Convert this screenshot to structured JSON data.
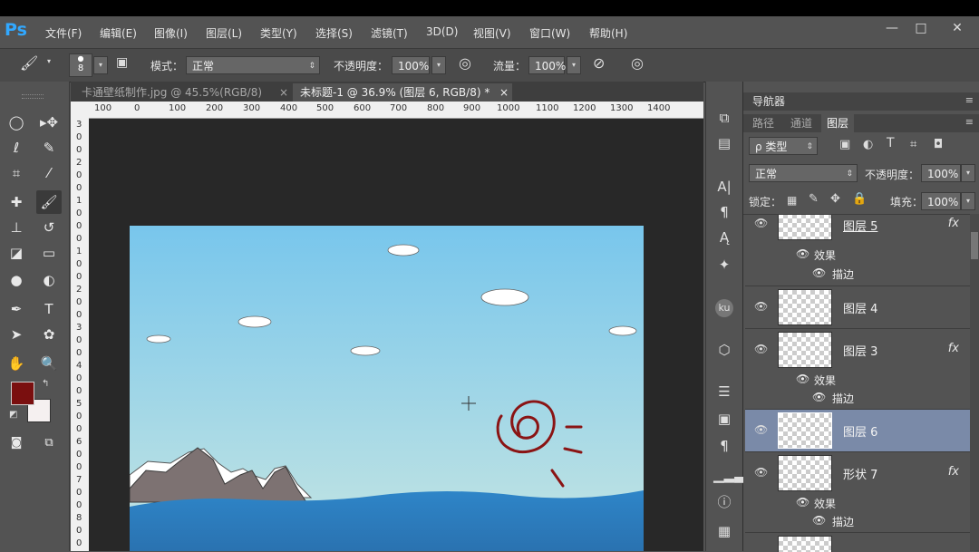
{
  "app": {
    "logo": "Ps"
  },
  "menu": [
    "文件(F)",
    "编辑(E)",
    "图像(I)",
    "图层(L)",
    "类型(Y)",
    "选择(S)",
    "滤镜(T)",
    "3D(D)",
    "视图(V)",
    "窗口(W)",
    "帮助(H)"
  ],
  "window_buttons": {
    "minimize": "—",
    "maximize": "□",
    "close": "✕"
  },
  "options": {
    "brush_size": "8",
    "mode_label": "模式：",
    "mode_value": "正常",
    "opacity_label": "不透明度：",
    "opacity_value": "100%",
    "flow_label": "流量：",
    "flow_value": "100%"
  },
  "tabs": [
    {
      "label": "卡通壁纸制作.jpg @ 45.5%(RGB/8)",
      "close": "×"
    },
    {
      "label": "未标题-1 @ 36.9% (图层 6, RGB/8) *",
      "close": "×"
    }
  ],
  "ruler_h": [
    "100",
    "0",
    "100",
    "200",
    "300",
    "400",
    "500",
    "600",
    "700",
    "800",
    "900",
    "1000",
    "1100",
    "1200",
    "1300",
    "1400"
  ],
  "ruler_v": [
    "3",
    "0",
    "0",
    "2",
    "0",
    "0",
    "1",
    "0",
    "0",
    "0",
    "1",
    "0",
    "0",
    "2",
    "0",
    "0",
    "3",
    "0",
    "0",
    "4",
    "0",
    "0",
    "5",
    "0",
    "0",
    "6",
    "0",
    "0",
    "7",
    "0",
    "0",
    "8",
    "0",
    "0"
  ],
  "colors": {
    "foreground": "#7a0f0f",
    "background": "#f5f0f0",
    "selection": "#7a8aa8",
    "sky_top": "#78c6ec",
    "sky_bottom": "#c5e5e2",
    "sea": "#2e85c8",
    "spiral": "#8a1414"
  },
  "panel": {
    "navigator_tab": "导航器",
    "tabs": [
      "路径",
      "通道",
      "图层"
    ],
    "filter_label": "ρ 类型",
    "blend_mode": "正常",
    "opacity_label": "不透明度：",
    "opacity_value": "100%",
    "lock_label": "锁定：",
    "fill_label": "填充：",
    "fill_value": "100%",
    "effects_label": "效果",
    "stroke_label": "描边",
    "layers": [
      {
        "name": "图层 5",
        "fx": "fx"
      },
      {
        "name": "图层 4"
      },
      {
        "name": "图层 3",
        "fx": "fx"
      },
      {
        "name": "图层 6"
      },
      {
        "name": "形状 7",
        "fx": "fx"
      }
    ]
  },
  "toolbar_icons": [
    "rect-marquee-icon",
    "move-icon",
    "lasso-icon",
    "quick-select-icon",
    "crop-icon",
    "eyedropper-icon",
    "healing-icon",
    "brush-icon",
    "stamp-icon",
    "history-brush-icon",
    "eraser-icon",
    "gradient-icon",
    "blur-icon",
    "dodge-icon",
    "pen-icon",
    "type-icon",
    "path-select-icon",
    "shape-icon",
    "hand-icon",
    "zoom-icon"
  ]
}
